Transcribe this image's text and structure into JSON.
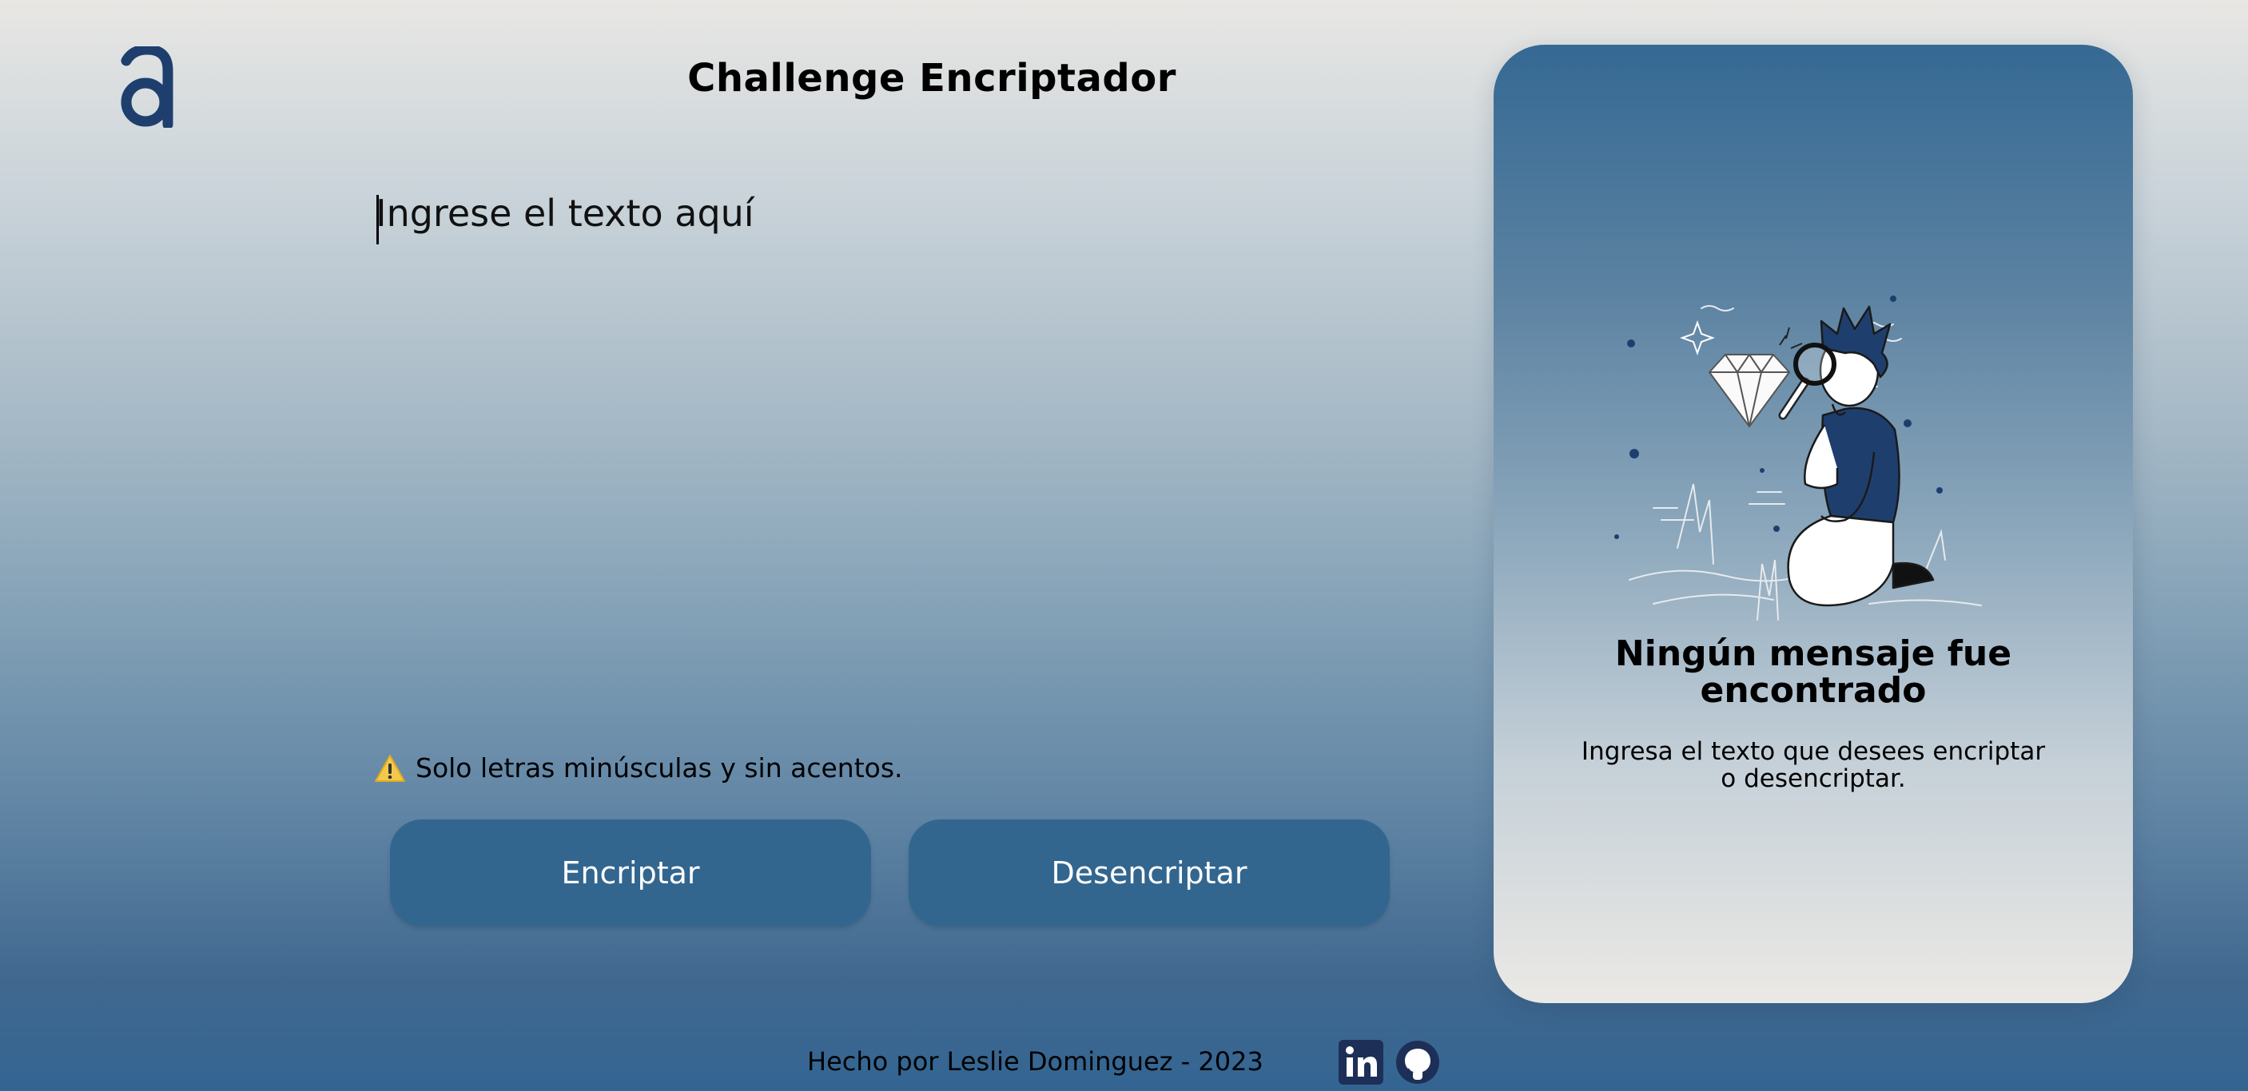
{
  "header": {
    "logo_icon": "alura-a-logo-icon",
    "title": "Challenge Encriptador"
  },
  "input": {
    "placeholder": "Ingrese el texto aquí",
    "value": ""
  },
  "notice": {
    "icon": "warning-icon",
    "text": "Solo letras minúsculas y sin acentos."
  },
  "actions": {
    "encrypt_label": "Encriptar",
    "decrypt_label": "Desencriptar"
  },
  "output_panel": {
    "illustration": "person-with-magnifying-glass-and-diamond-illustration",
    "title_line1": "Ningún mensaje fue",
    "title_line2": "encontrado",
    "subtitle_line1": "Ingresa el texto que desees encriptar",
    "subtitle_line2": "o desencriptar."
  },
  "footer": {
    "credit": "Hecho por Leslie Dominguez - 2023",
    "links": [
      "linkedin-icon",
      "github-icon"
    ]
  },
  "colors": {
    "primary": "#32668f",
    "logo": "#1e3f6e",
    "social_icon": "#1e2f57"
  }
}
